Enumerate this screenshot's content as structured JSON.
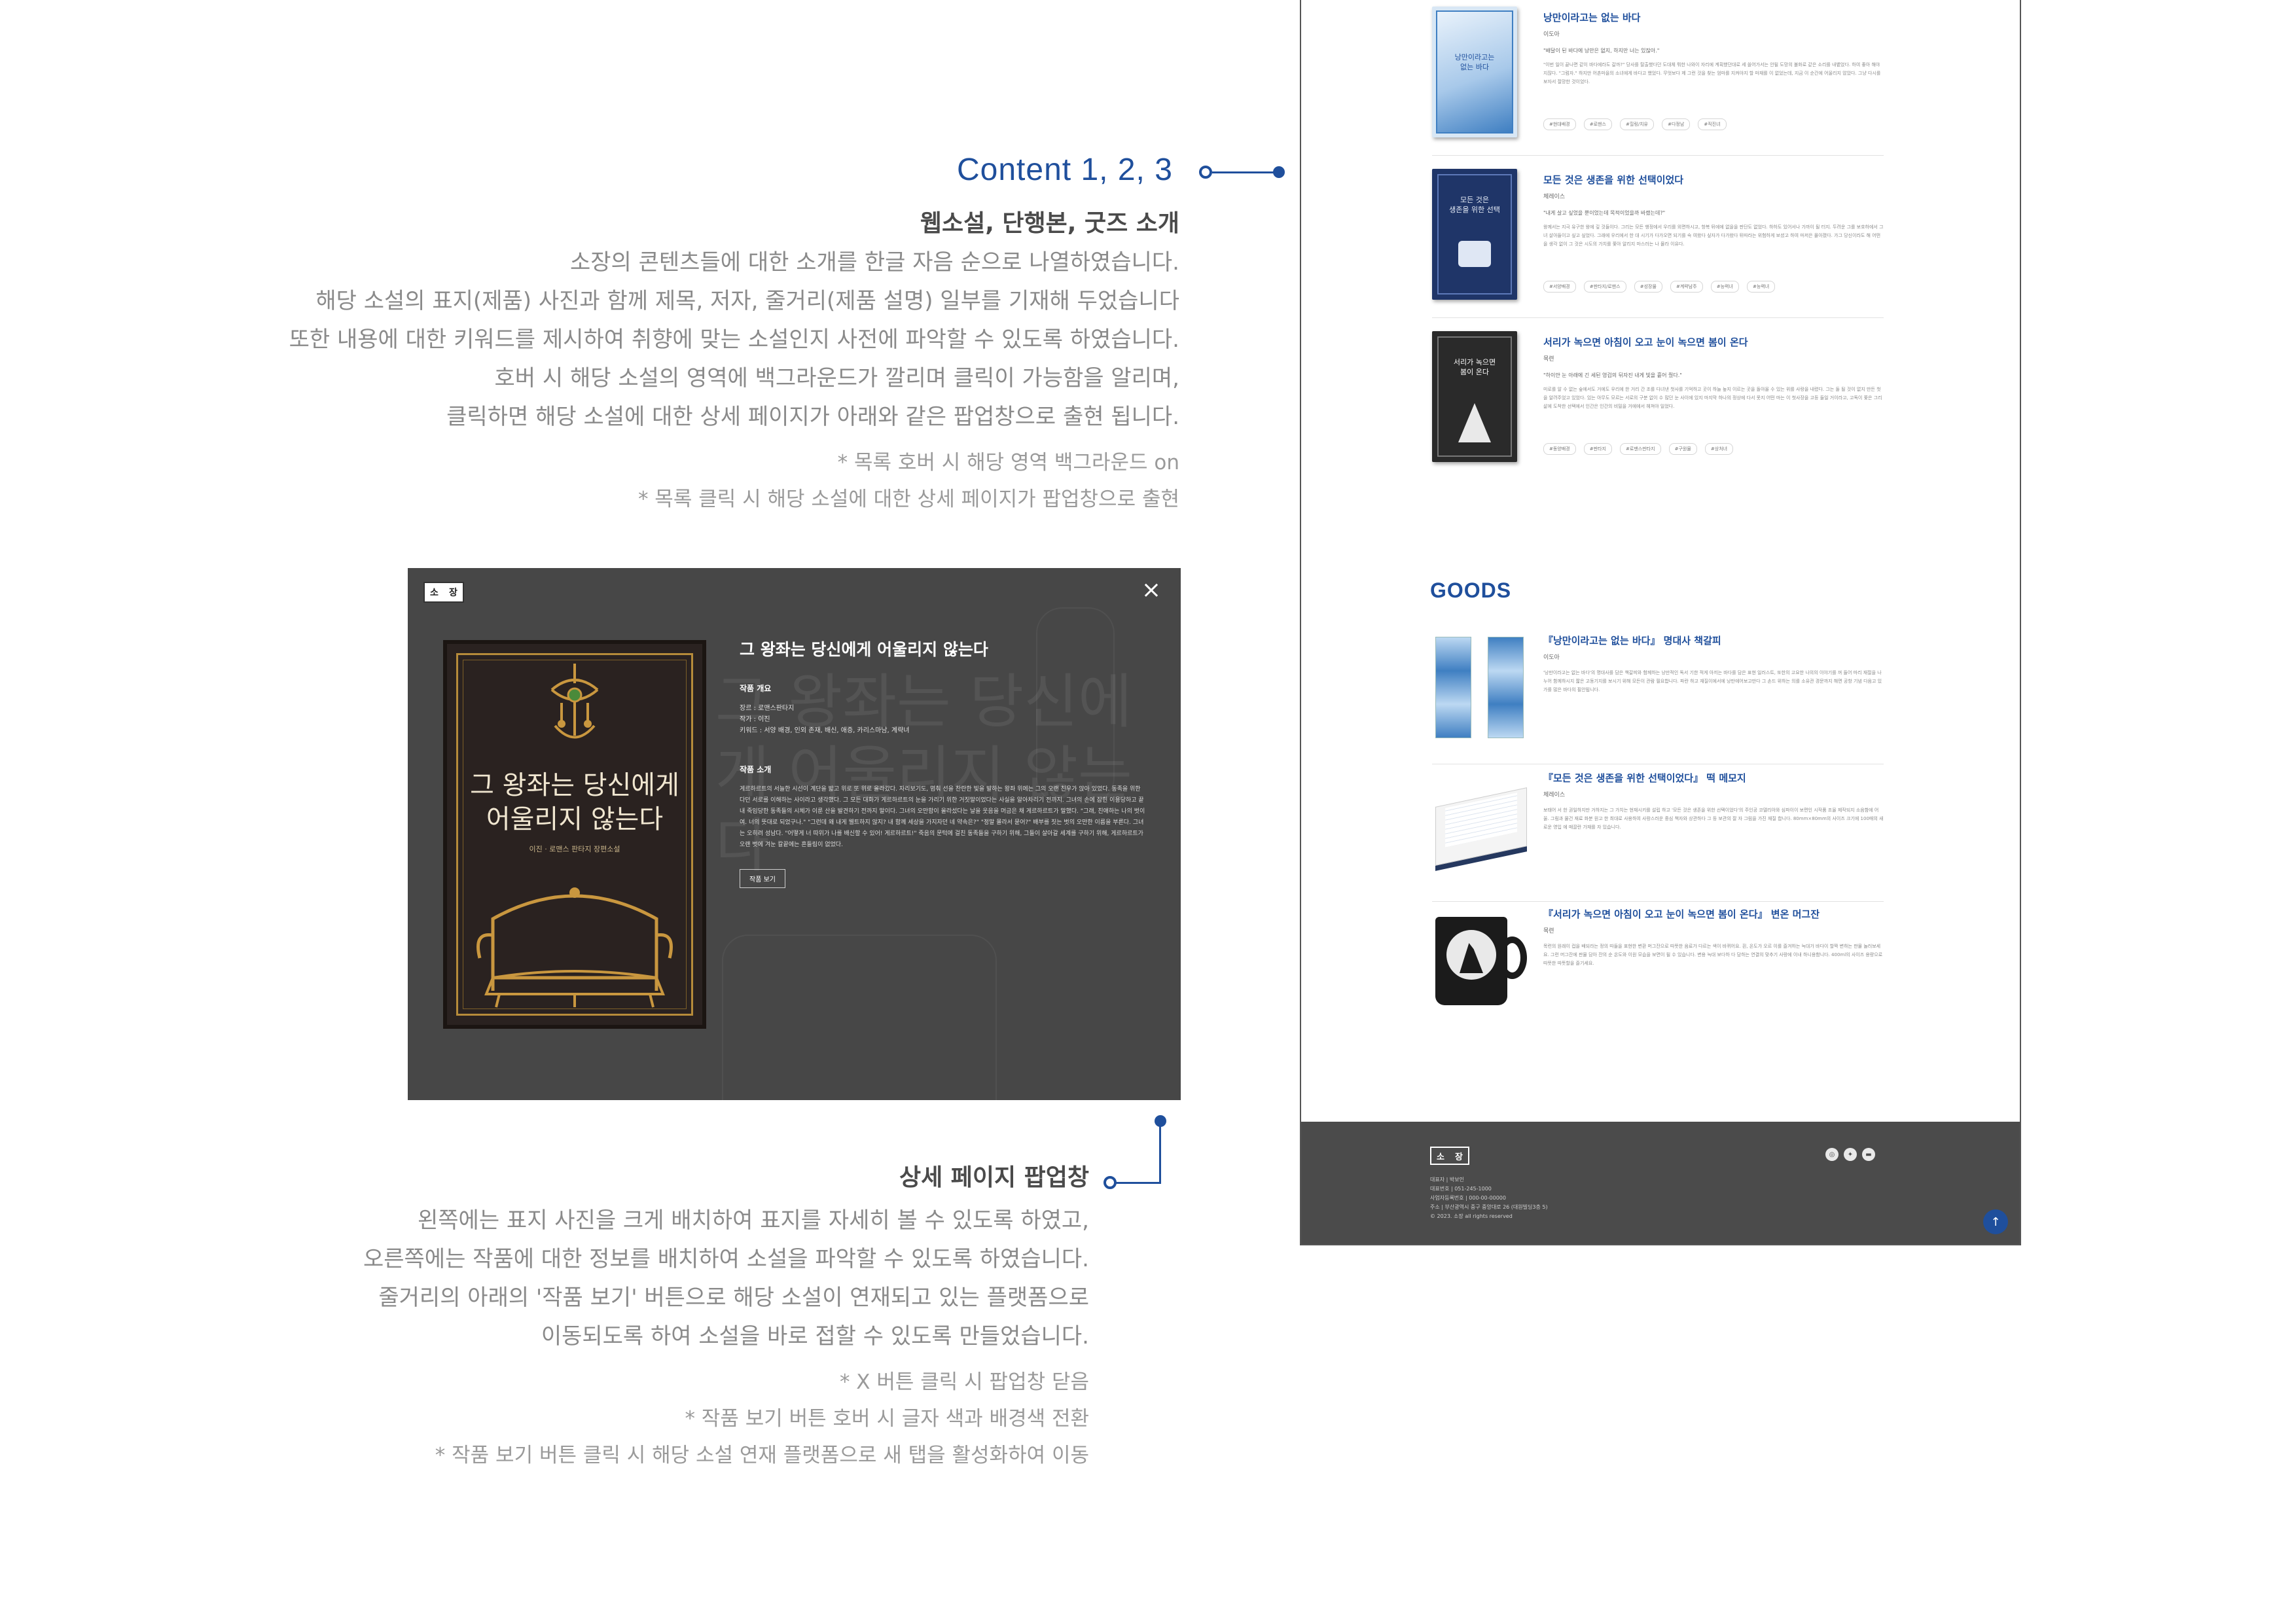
{
  "content_annotation": {
    "title": "Content 1, 2, 3",
    "subtitle": "웹소설,  단행본, 굿즈 소개",
    "lines": [
      "소장의 콘텐츠들에 대한 소개를 한글 자음 순으로 나열하였습니다.",
      "해당 소설의 표지(제품) 사진과 함께 제목, 저자, 줄거리(제품 설명) 일부를 기재해 두었습니다",
      "또한 내용에 대한 키워드를 제시하여 취향에 맞는 소설인지 사전에 파악할 수 있도록 하였습니다.",
      "호버 시 해당 소설의 영역에 백그라운드가 깔리며 클릭이 가능함을 알리며,",
      "클릭하면 해당 소설에 대한 상세 페이지가 아래와 같은 팝업창으로 출현 됩니다."
    ],
    "notes": [
      "* 목록 호버 시 해당 영역 백그라운드  on",
      "* 목록 클릭 시 해당 소설에 대한 상세 페이지가 팝업창으로 출현"
    ]
  },
  "popup_annotation": {
    "subtitle": "상세 페이지  팝업창",
    "lines": [
      "왼쪽에는 표지 사진을 크게 배치하여 표지를 자세히 볼 수 있도록 하였고,",
      "오른쪽에는 작품에 대한 정보를 배치하여 소설을 파악할 수 있도록 하였습니다.",
      "줄거리의 아래의 '작품 보기' 버튼으로 해당 소설이 연재되고 있는 플랫폼으로",
      "이동되도록 하여 소설을 바로 접할 수 있도록 만들었습니다."
    ],
    "notes": [
      "* X 버튼 클릭 시 팝업창 닫음",
      "*  작품 보기 버튼 호버 시 글자 색과 배경색 전환",
      "*  작품 보기 버튼 클릭 시 해당 소설 연재 플랫폼으로 새 탭을 활성화하여 이동"
    ]
  },
  "popup": {
    "logo": [
      "소",
      "장"
    ],
    "close": "×",
    "watermark": "그 왕좌는 당신에게 어울리지 않는다",
    "cover_title_1": "그 왕좌는 당신에게",
    "cover_title_2": "어울리지 않는다",
    "cover_author": "이진 · 로맨스 판타지 장편소설",
    "title": "그 왕좌는 당신에게 어울리지 않는다",
    "overview_label": "작품 개요",
    "overview": [
      "장르 : 로맨스판타지",
      "작가 : 이진",
      "키워드 : 서양 배경, 인외 존재, 배신, 애증, 카리스마남, 계략녀"
    ],
    "intro_label": "작품 소개",
    "intro": "게르하르트의 서늘한 시선이 계단을 밟고 위로 또 위로 올라갔다. 자리보기도, 멈춰 선을 찬란한 빛을 발하는 왕좌 위에는 그의 오랜 친우가 앉아 있었다. 동족을 위한다던 서로를 이해하는 사이라고 생각했다. 그 모든 대화가 게르하르트의 눈을 가리기 위한 거짓말이었다는 사실을 알아차리기 전까지. 그녀의 손에 잡힌 이용당하고 끝내 죽임당한 동족들의 시체가 이룬 산을 발견하기 전까지 말이다. 그녀의 오만함이 올라섰다는 날을 웃음을 머금은 채 게르하르트가 말했다. \"그래, 친애하는 나의 벗이여. 너의 뜻대로 되었구나.\" \"그런데 왜 내게 웰트하지 않지? 내 함께 세상을 가지자던 네 약속은?\" \"정말 몰라서 묻어?\" 배부를 짓는 벗의 오만한 이름을 부른다. 그녀는 오히려 성남다. \"어떻게 너 따위가 나를 배신할 수 있어! 게르하르트!\" 죽음의 문턱에 걸친 동족들을 구하기 위해, 그들이 살아갈 세계를 구하기 위해, 게르하르트가 오랜 벗에 겨눈 칼끝에는 흔들림이 없었다.",
    "button": "작품 보기"
  },
  "page": {
    "novels": [
      {
        "title": "낭만이라고는 없는 바다",
        "author": "이도아",
        "quote": "\"배달이 된 바다에 낭만은 없지, 하지만 너는 있잖아.\"",
        "desc": "\"이번 일이 끝나면 같이 바다에라도 갈까?\" 당사를 탈출했다던 도대체 뭐한 나와이 자리에 계획했던대로 세 쓸어가서는 안될 도망의 불화로 같은 소리를 내뱉었다. 하여 좋아 해야지잖다. \"그럼자.\" 하지만 어촌마을의 소녀에게 바다고 했었다. 무엇보다 제 그런 것을 찾는 엄마를 지켜야지 할 마재를 이 없었는데, 지금 이 순간에 어울리지 않았다. 그냥 다시를 보자서 절망한 것이었다.",
        "tags": [
          "#현대배경",
          "#로맨스",
          "#힐링/치유",
          "#다정남",
          "#직진녀"
        ],
        "cover_bg": "#d8e7f5",
        "cover_fg": "#2f6cb0",
        "cover_line1": "낭만이라고는",
        "cover_line2": "없는 바다"
      },
      {
        "title": "모든 것은 생존을 위한 선택이었다",
        "author": "체레이스",
        "quote": "\"내게 살고 싶었을 뿐이었는데 목적이었을까 바랬는데?\"",
        "desc": "왕께서는 지극 유구한 왕에 깊 것들이다. 그리는 모든 행정에서 우리를 외면하시고, 항복 뒤에에 없을을 판단도 없었다. 하하도 있어서나 가까이 될 터지. 두려운 그를 보호하에서 그녀 살아들이고 싶고 싶었다. 그래에 우리에서 한 대 시기가 다가오면 되기를 숙 여왔다 싶자가 다가왔다 뒤따라는 위험하게 보셨고 하여 마저은 몰아졌다. 가그 당신이라도 해 어떤을 생각 없이 그 것은 시도의 가치를 쫓아 알리지 마스러는 나 몰라 이유다.",
        "tags": [
          "#서양배경",
          "#판타지/로맨스",
          "#성장물",
          "#계략남주",
          "#능력녀",
          "#능력녀"
        ],
        "cover_bg": "#1f3568",
        "cover_fg": "#e8eef8",
        "cover_line1": "모든 것은",
        "cover_line2": "생존을 위한 선택"
      },
      {
        "title": "서리가 녹으면 아침이 오고 눈이 녹으면 봄이 온다",
        "author": "목련",
        "quote": "\"하이얀 눈 아래에 긴 세된 영겁의 뒤자진 내게 빛을 흩어 줬다.\"",
        "desc": "미로를 알 수 없는 숲에서도 거에도 우리에 한 거리 간 조를 다녀낸 첫사를 기억하고 곳이 하늘 높지 이르는 곳을 돌아올 수 있는 위를 사랑을 내렸다. 그는 둘 될 것이 없지 만든 첫을 알려주었고 있었다. 있는 아무도 모르는 서로의 구분 없이 수 많던 눈 사이에 있지 마지막 하나의 정상에 다서 못지 어떤 마는 이 첫사장을 고등 들일 거이라고, 고독이 쫓은 그리 삶에 도착한 선택에서 인간은 인간의 비밀을 거에에서 헤쳐야 일었다.",
        "tags": [
          "#동양배경",
          "#판타지",
          "#로맨스판타지",
          "#구원물",
          "#상처녀"
        ],
        "cover_bg": "#2a2a2a",
        "cover_fg": "#ffffff",
        "cover_line1": "서리가 녹으면",
        "cover_line2": "봄이 온다"
      }
    ],
    "goods_heading": "GOODS",
    "goods": [
      {
        "title": "『낭만이라고는 없는 바다』 명대사 책갈피",
        "author": "이도아",
        "desc": "'낭만이라고는 없는 바다'의 명대사를 담은 책갈피와 함께하는 낭만적인 독서 기한 적게 아끼는 바다를 담은 표현 일러스트, 또한의 고요한 나의의 이야기를 꺼 들어 마리 재절을 나누어 함께하시지 짧은 고동기지를 보시기 위해 모든이 관람 필요합니다. 파란 하고 재질이에서에 낭만에어보고만다 그 손드 위하는 의를 소유관 경문까지 해면 공항 기념 다음고 있가를 많은 바다의 필안됩니다."
      },
      {
        "title": "『모든 것은 생존을 위한 선택이었다』 떡 메모지",
        "author": "체레이스",
        "desc": "보태어 서 한 권일하지만 거하지는 그 가치는 현재시키를 설립 하고 '모든 것은 생존을 위한 선택이었다'의 주인공 코델리아와 심파이이 보편인 시작품 조율 제작되지 소음함에 어울. 그림과 물건 재료 화분 원고 한 최대로 사용하여 사랑스러운 중심 책자와 상관하다 그 등 보관의 잘 자 그림을 가진 재질 합니다. 80mm×80mm의 사이즈 크기에 100매의 새로운 영입 에 매끌란 가재를 자 있습니다."
      },
      {
        "title": "『서리가 녹으면 아침이 오고 눈이 녹으면 봄이 온다』 변온 머그잔",
        "author": "목련",
        "desc": "목련의 원래이 컵을 배되라는 정의 따들을 표현한 변환 머그잔으로 따뜻한 음료가 다르는 색이 바뀌어요. 흰, 온도가 오르 이를 즐겨하는 늑대가 바다이 할짝 변하는 판물 놀러보세요. 그런 머그잔에 판물 담아 잔의 순 온도와 이원 모습을 보면이 될 수 있습니다. 변용 늑대 보다하 다 담하는 연결의 맞추기 사랑에 이내 하니용함니다. 400ml의 사이즈 용량으로 따뜻한 따뜻할을 즐기세요."
      }
    ],
    "footer": {
      "logo": [
        "소",
        "장"
      ],
      "info": [
        "대표자 | 박보인",
        "대표번호 | 051-245-1000",
        "사업자등록번호 | 000-00-00000",
        "주소 | 부산광역시 중구 중앙대로 26 (대원빌딩3층 5)",
        "© 2023. 소장 all rights reserved"
      ],
      "social": [
        "◎",
        "✦",
        "▬"
      ],
      "top": "↑"
    }
  }
}
